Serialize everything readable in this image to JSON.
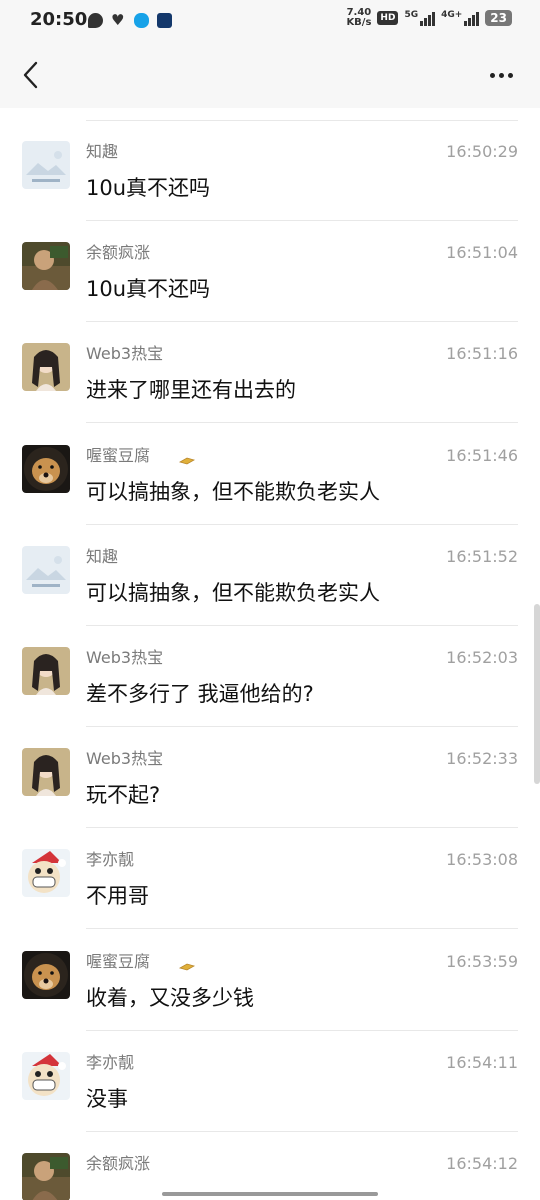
{
  "status_bar": {
    "time": "20:50",
    "net_speed_value": "7.40",
    "net_speed_unit": "KB/s",
    "hd_badge": "HD",
    "sim1_label": "5G",
    "sim2_label": "4G+",
    "battery": "23",
    "left_icons": [
      "wechat-icon",
      "heart-icon",
      "qq-icon",
      "app-icon"
    ]
  },
  "nav": {
    "back_icon": "chevron-left-icon",
    "more_icon": "more-horizontal-icon"
  },
  "messages": [
    {
      "sender": "知趣",
      "time": "16:50:29",
      "text": "10u真不还吗",
      "avatar": "zhiqu",
      "badge": false
    },
    {
      "sender": "余额疯涨",
      "time": "16:51:04",
      "text": "10u真不还吗",
      "avatar": "yue",
      "badge": false
    },
    {
      "sender": "Web3热宝",
      "time": "16:51:16",
      "text": "进来了哪里还有出去的",
      "avatar": "web3",
      "badge": false
    },
    {
      "sender": "喔蜜豆腐",
      "time": "16:51:46",
      "text": "可以搞抽象，但不能欺负老实人",
      "avatar": "dog",
      "badge": true
    },
    {
      "sender": "知趣",
      "time": "16:51:52",
      "text": "可以搞抽象，但不能欺负老实人",
      "avatar": "zhiqu",
      "badge": false
    },
    {
      "sender": "Web3热宝",
      "time": "16:52:03",
      "text": "差不多行了 我逼他给的?",
      "avatar": "web3",
      "badge": false
    },
    {
      "sender": "Web3热宝",
      "time": "16:52:33",
      "text": "玩不起?",
      "avatar": "web3",
      "badge": false
    },
    {
      "sender": "李亦靓",
      "time": "16:53:08",
      "text": "不用哥",
      "avatar": "santa",
      "badge": false
    },
    {
      "sender": "喔蜜豆腐",
      "time": "16:53:59",
      "text": "收着，又没多少钱",
      "avatar": "dog",
      "badge": true
    },
    {
      "sender": "李亦靓",
      "time": "16:54:11",
      "text": "没事",
      "avatar": "santa",
      "badge": false
    },
    {
      "sender": "余额疯涨",
      "time": "16:54:12",
      "text": "",
      "avatar": "yue",
      "badge": false
    }
  ],
  "colors": {
    "header_bg": "#f7f7f7",
    "sender": "#7a7a7a",
    "time": "#a0a0a0",
    "text": "#111111",
    "divider": "#e8e8e8",
    "badge_gold": "#e0b03a"
  }
}
